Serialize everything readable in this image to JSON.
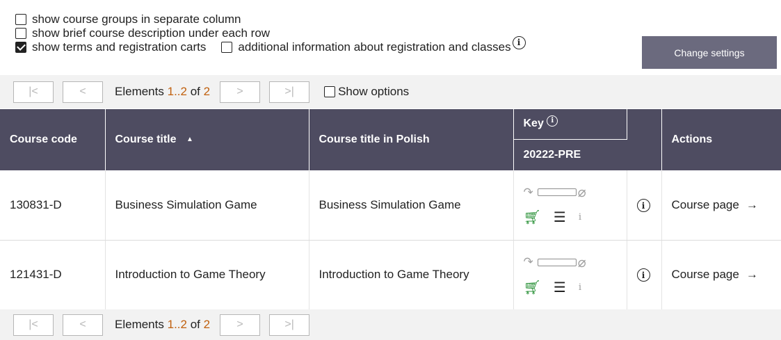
{
  "settings": {
    "opt_groups": "show course groups in separate column",
    "opt_desc": "show brief course description under each row",
    "opt_terms": "show terms and registration carts",
    "opt_additional": "additional information about registration and classes",
    "change_button": "Change settings"
  },
  "pager": {
    "first": "|<",
    "prev": "<",
    "next": ">",
    "last": ">|",
    "elements_label": "Elements",
    "range": "1..2",
    "of_label": "of",
    "total": "2",
    "show_options": "Show options"
  },
  "table": {
    "headers": {
      "code": "Course code",
      "title": "Course title",
      "title_pl": "Course title in Polish",
      "key": "Key",
      "term": "20222-PRE",
      "actions": "Actions"
    },
    "rows": [
      {
        "code": "130831-D",
        "title": "Business Simulation Game",
        "title_pl": "Business Simulation Game",
        "action": "Course page"
      },
      {
        "code": "121431-D",
        "title": "Introduction to Game Theory",
        "title_pl": "Introduction to Game Theory",
        "action": "Course page"
      }
    ]
  },
  "icons": {
    "info": "ⓘ",
    "sort_asc": "▲",
    "arrow_right": "→",
    "cart": "cart-icon",
    "list": "list-icon",
    "clip": "paperclip-icon"
  },
  "colors": {
    "header_bg": "#4e4c61",
    "button_bg": "#6b6a7e",
    "pager_bg": "#f2f2f2",
    "accent_number": "#c0600e",
    "cart_green": "#1b8a2a"
  }
}
